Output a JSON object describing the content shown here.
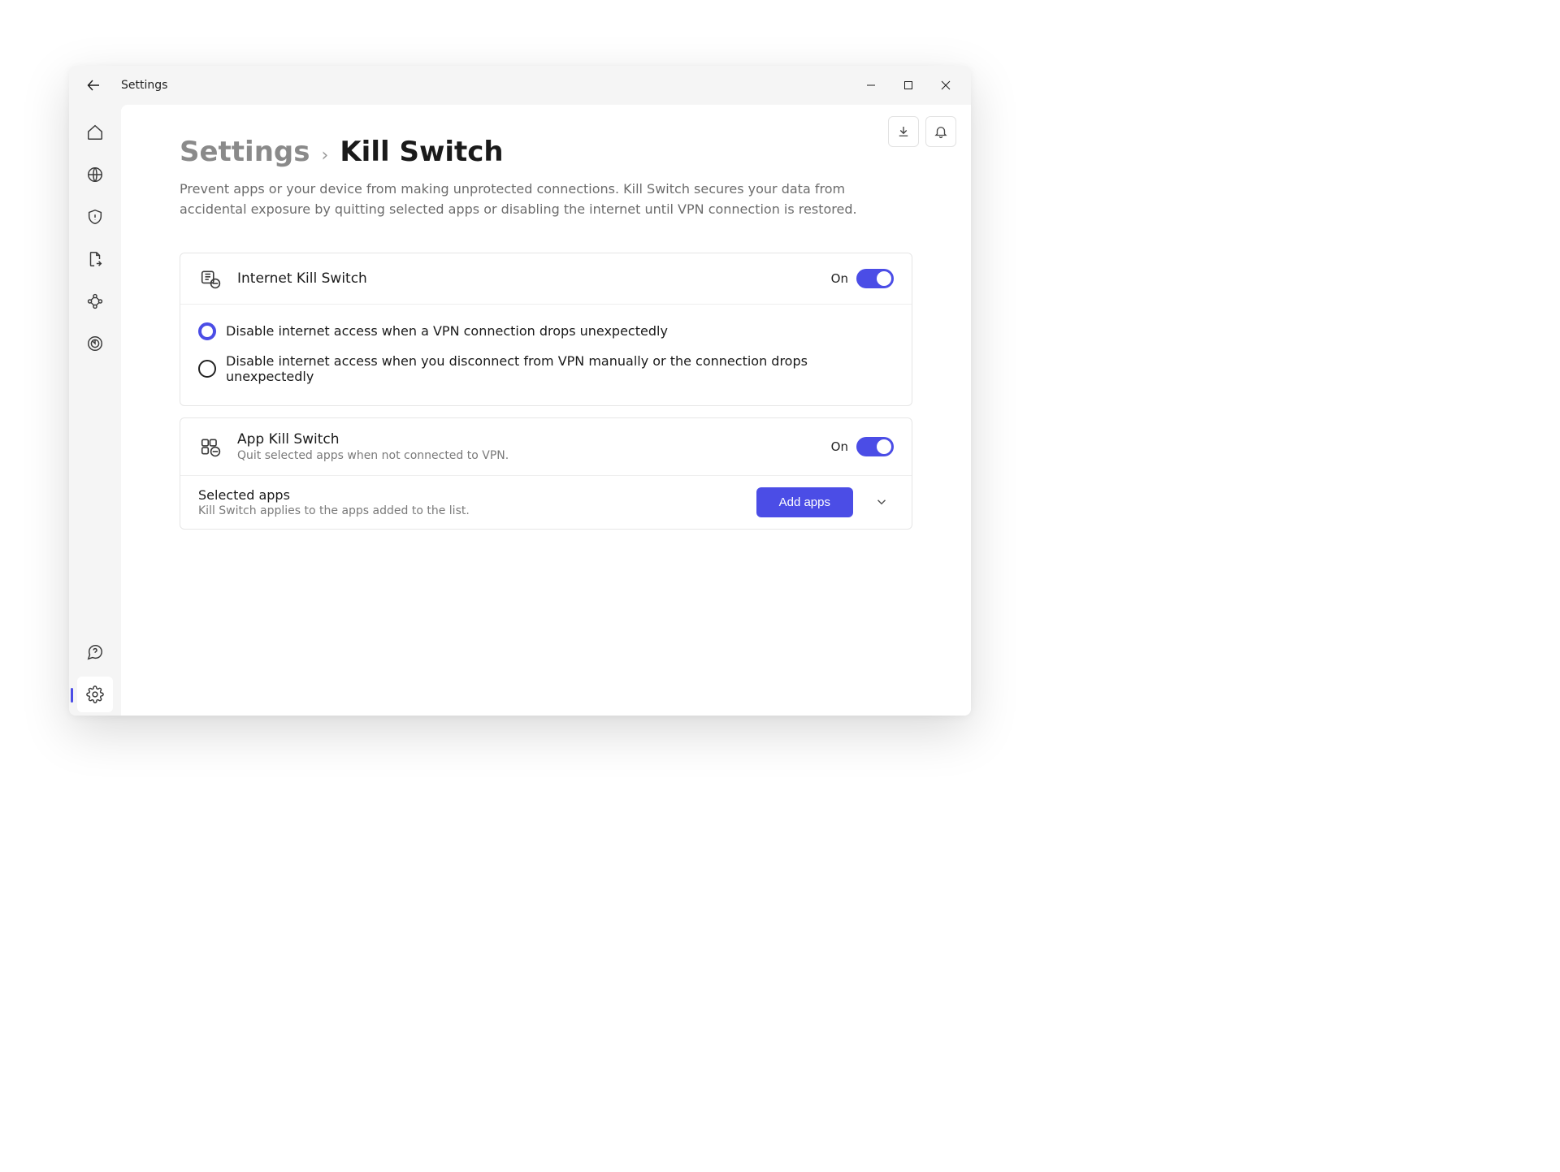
{
  "window": {
    "title": "Settings"
  },
  "breadcrumb": {
    "parent": "Settings",
    "sep": "›",
    "current": "Kill Switch"
  },
  "page_description": "Prevent apps or your device from making unprotected connections. Kill Switch secures your data from accidental exposure by quitting selected apps or disabling the internet until VPN connection is restored.",
  "internet_ks": {
    "title": "Internet Kill Switch",
    "state_label": "On",
    "on": true,
    "options": [
      {
        "label": "Disable internet access when a VPN connection drops unexpectedly",
        "selected": true
      },
      {
        "label": "Disable internet access when you disconnect from VPN manually or the connection drops unexpectedly",
        "selected": false
      }
    ]
  },
  "app_ks": {
    "title": "App Kill Switch",
    "subtitle": "Quit selected apps when not connected to VPN.",
    "state_label": "On",
    "on": true
  },
  "selected_apps": {
    "title": "Selected apps",
    "subtitle": "Kill Switch applies to the apps added to the list.",
    "button": "Add apps"
  },
  "colors": {
    "accent": "#4b4de6"
  }
}
